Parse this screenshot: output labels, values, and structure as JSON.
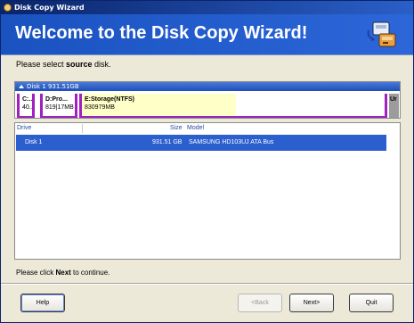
{
  "window": {
    "title": "Disk Copy Wizard"
  },
  "banner": {
    "heading": "Welcome to the Disk Copy Wizard!"
  },
  "prompt": {
    "before": "Please select ",
    "bold": "source",
    "after": " disk."
  },
  "disk_map": {
    "header": "Disk 1  931.51GB",
    "partitions": [
      {
        "name": "C:...",
        "size": "40..."
      },
      {
        "name": "D:Pro...",
        "size": "819|17MB"
      },
      {
        "name": "E:Storage(NTFS)",
        "size": "830979MB"
      },
      {
        "name": "Ur",
        "size": ""
      }
    ]
  },
  "table": {
    "columns": [
      "Drive",
      "Size",
      "Model"
    ],
    "rows": [
      {
        "drive": "Disk 1",
        "size": "931.51 GB",
        "model": "SAMSUNG HD103UJ ATA Bus"
      }
    ]
  },
  "footer": {
    "before": "Please click ",
    "bold": "Next",
    "after": " to continue."
  },
  "buttons": {
    "help": "Help",
    "back": "<Back",
    "next": "Next>",
    "quit": "Quit"
  }
}
